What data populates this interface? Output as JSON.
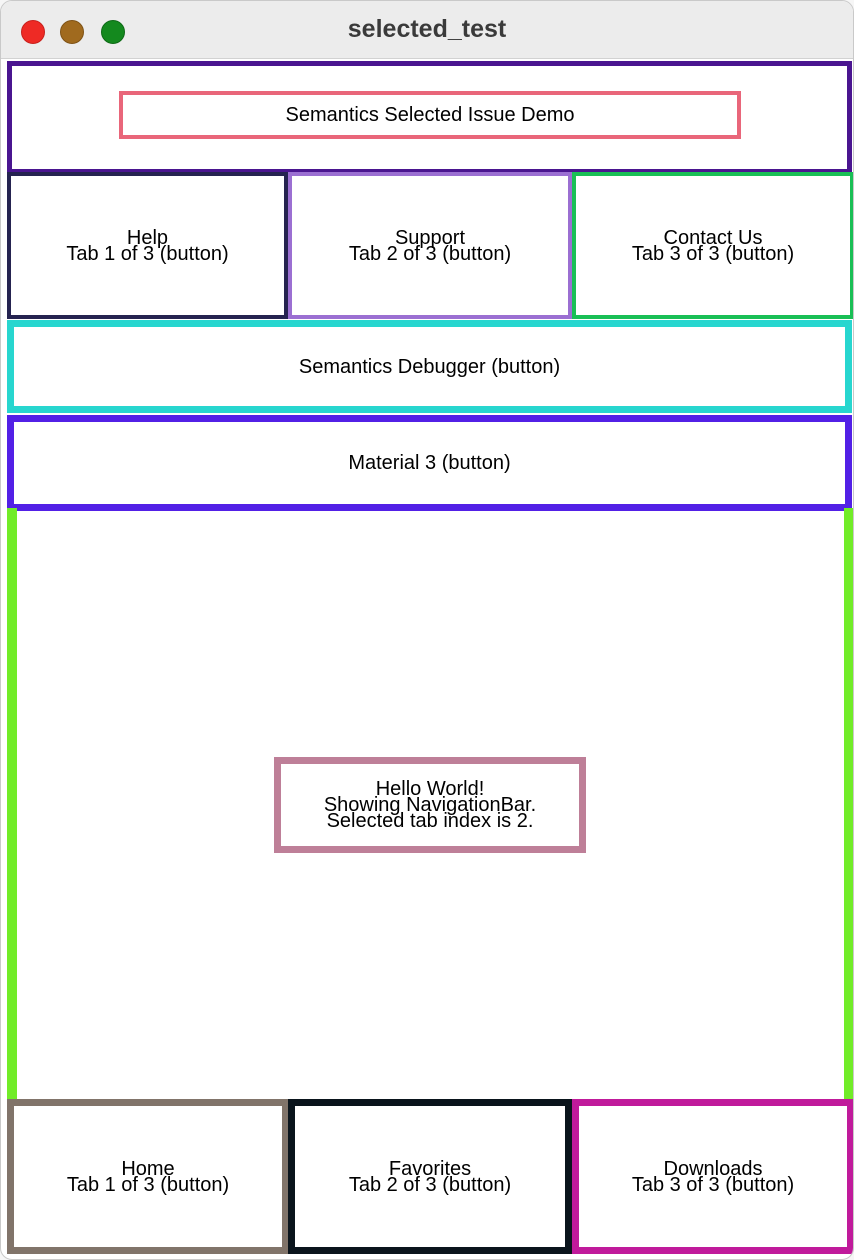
{
  "window": {
    "title": "selected_test"
  },
  "appbar": {
    "title": "Semantics Selected Issue Demo"
  },
  "top_tabs": [
    {
      "label": "Help",
      "hint": "Tab 1 of 3 (button)"
    },
    {
      "label": "Support",
      "hint": "Tab 2 of 3 (button)"
    },
    {
      "label": "Contact Us",
      "hint": "Tab 3 of 3 (button)"
    }
  ],
  "buttons": {
    "debugger": "Semantics Debugger (button)",
    "material": "Material 3 (button)"
  },
  "body": {
    "line1": "Hello World!",
    "line2": "Showing NavigationBar.",
    "line3": "Selected tab index is 2."
  },
  "nav_tabs": [
    {
      "label": "Home",
      "hint": "Tab 1 of 3 (button)"
    },
    {
      "label": "Favorites",
      "hint": "Tab 2 of 3 (button)"
    },
    {
      "label": "Downloads",
      "hint": "Tab 3 of 3 (button)"
    }
  ],
  "colors": {
    "close": "#ee2a25",
    "minimize": "#a06a1e",
    "zoom": "#14891e"
  }
}
